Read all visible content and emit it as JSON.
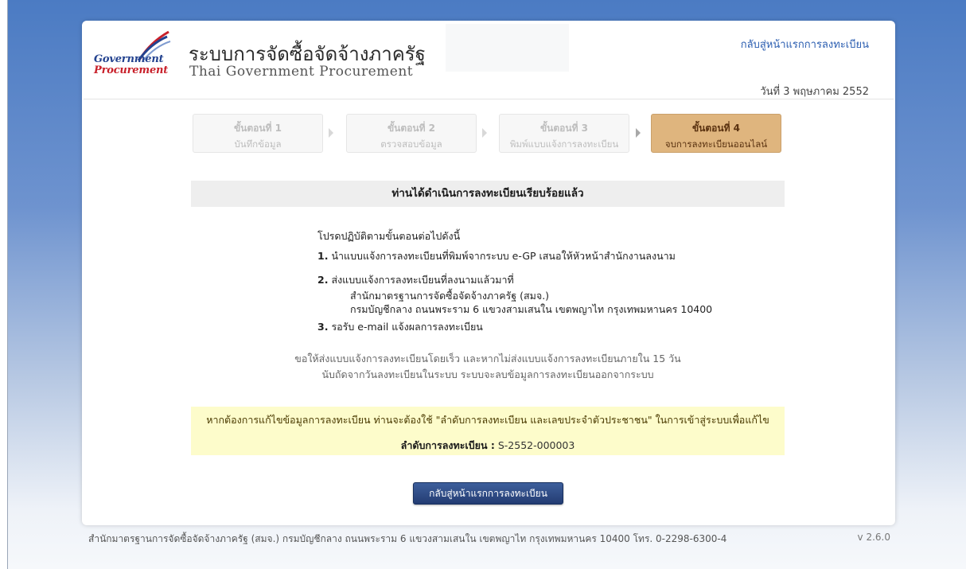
{
  "header": {
    "logo_line1": "Government",
    "logo_line2": "Procurement",
    "title_th": "ระบบการจัดซื้อจัดจ้างภาครัฐ",
    "title_en": "Thai Government Procurement",
    "back_link": "กลับสู่หน้าแรกการลงทะเบียน",
    "date": "วันที่ 3 พฤษภาคม 2552"
  },
  "steps": [
    {
      "number": "ขั้นตอนที่ 1",
      "label": "บันทึกข้อมูล",
      "active": false
    },
    {
      "number": "ขั้นตอนที่ 2",
      "label": "ตรวจสอบข้อมูล",
      "active": false
    },
    {
      "number": "ขั้นตอนที่ 3",
      "label": "พิมพ์แบบแจ้งการลงทะเบียน",
      "active": false
    },
    {
      "number": "ขั้นตอนที่ 4",
      "label": "จบการลงทะเบียนออนไลน์",
      "active": true
    }
  ],
  "banner": "ท่านได้ดำเนินการลงทะเบียนเรียบร้อยแล้ว",
  "instructions": {
    "intro": "โปรดปฏิบัติตามขั้นตอนต่อไปดังนี้",
    "item1_num": "1.",
    "item1": "นำแบบแจ้งการลงทะเบียนที่พิมพ์จากระบบ e-GP เสนอให้หัวหน้าสำนักงานลงนาม",
    "item2_num": "2.",
    "item2": "ส่งแบบแจ้งการลงทะเบียนที่ลงนามแล้วมาที่",
    "item2_addr1": "สำนักมาตรฐานการจัดซื้อจัดจ้างภาครัฐ (สมจ.)",
    "item2_addr2": "กรมบัญชีกลาง ถนนพระราม 6 แขวงสามเสนใน เขตพญาไท กรุงเทพมหานคร 10400",
    "item3_num": "3.",
    "item3": "รอรับ e-mail แจ้งผลการลงทะเบียน"
  },
  "note": {
    "line1": "ขอให้ส่งแบบแจ้งการลงทะเบียนโดยเร็ว และหากไม่ส่งแบบแจ้งการลงทะเบียนภายใน 15 วัน",
    "line2": "นับถัดจากวันลงทะเบียนในระบบ ระบบจะลบข้อมูลการลงทะเบียนออกจากระบบ"
  },
  "notice": {
    "text": "หากต้องการแก้ไขข้อมูลการลงทะเบียน ท่านจะต้องใช้ \"ลำดับการลงทะเบียน และเลขประจำตัวประชาชน\" ในการเข้าสู่ระบบเพื่อแก้ไข",
    "reg_label": "ลำดับการลงทะเบียน :",
    "reg_value": "S-2552-000003"
  },
  "button_label": "กลับสู่หน้าแรกการลงทะเบียน",
  "footer": "สำนักมาตรฐานการจัดซื้อจัดจ้างภาครัฐ (สมจ.) กรมบัญชีกลาง ถนนพระราม 6 แขวงสามเสนใน เขตพญาไท กรุงเทพมหานคร 10400 โทร. 0-2298-6300-4",
  "version": "v 2.6.0",
  "colors": {
    "accent": "#2a5db0",
    "active_step": "#dfb57e",
    "notice_bg": "#fdfccb",
    "button": "#2c4a85"
  }
}
